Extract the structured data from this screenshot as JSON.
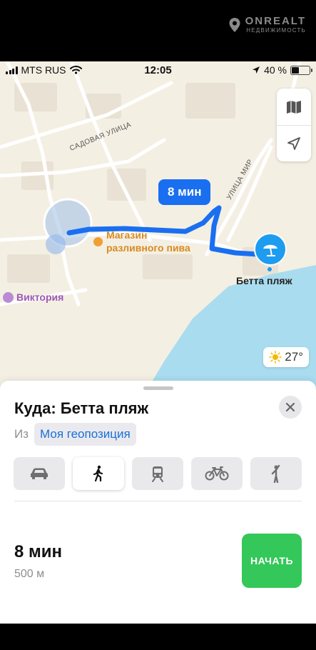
{
  "watermark": {
    "title": "ONREALT",
    "subtitle": "НЕДВИЖИМОСТЬ"
  },
  "status_bar": {
    "carrier": "MTS RUS",
    "time": "12:05",
    "battery_text": "40 %",
    "battery_level": 0.4,
    "icons": [
      "signal-icon",
      "wifi-icon",
      "location-arrow-icon",
      "battery-icon"
    ]
  },
  "map": {
    "street_sadovaya": "САДОВАЯ УЛИЦА",
    "street_mira": "УЛИЦА МИР",
    "poi_shop": {
      "line1": "Магазин",
      "line2": "разливного пива"
    },
    "poi_viktoria": "Виктория",
    "eta_bubble": "8 мин",
    "destination_label": "Бетта пляж",
    "weather_temp": "27°",
    "controls": [
      "map-icon",
      "location-arrow-icon"
    ]
  },
  "sheet": {
    "title": "Куда: Бетта пляж",
    "from_label": "Из",
    "from_value": "Моя геопозиция",
    "modes": [
      "car-icon",
      "walk-icon",
      "transit-icon",
      "bike-icon",
      "rideshare-icon"
    ],
    "active_mode": "walk-icon",
    "route_time": "8 мин",
    "route_distance": "500 м",
    "start_label": "НАЧАТЬ"
  },
  "colors": {
    "route": "#1a6ff0",
    "water": "#a9dcef",
    "map_bg": "#f4efe3",
    "start": "#34c759"
  }
}
